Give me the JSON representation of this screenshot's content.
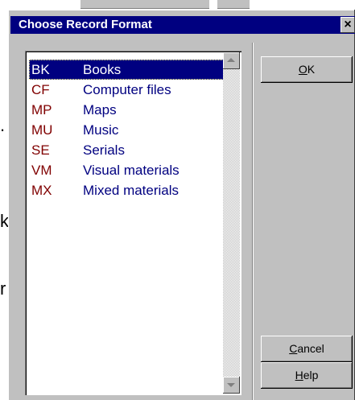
{
  "dialog": {
    "title": "Choose Record Format",
    "close_label": "×"
  },
  "list": {
    "items": [
      {
        "code": "BK",
        "label": "Books",
        "selected": true
      },
      {
        "code": "CF",
        "label": "Computer files",
        "selected": false
      },
      {
        "code": "MP",
        "label": "Maps",
        "selected": false
      },
      {
        "code": "MU",
        "label": "Music",
        "selected": false
      },
      {
        "code": "SE",
        "label": "Serials",
        "selected": false
      },
      {
        "code": "VM",
        "label": "Visual materials",
        "selected": false
      },
      {
        "code": "MX",
        "label": "Mixed materials",
        "selected": false
      }
    ]
  },
  "buttons": {
    "ok": {
      "mnemonic": "O",
      "rest": "K"
    },
    "cancel": {
      "mnemonic": "C",
      "rest": "ancel"
    },
    "help": {
      "mnemonic": "H",
      "rest": "elp"
    }
  },
  "background": {
    "fragment_1": ".",
    "fragment_2": "k",
    "fragment_3": "r"
  },
  "colors": {
    "title_bar": "#000080",
    "selection": "#000080",
    "code_text": "#800000",
    "label_text": "#000080",
    "dialog_face": "#c0c0c0"
  }
}
